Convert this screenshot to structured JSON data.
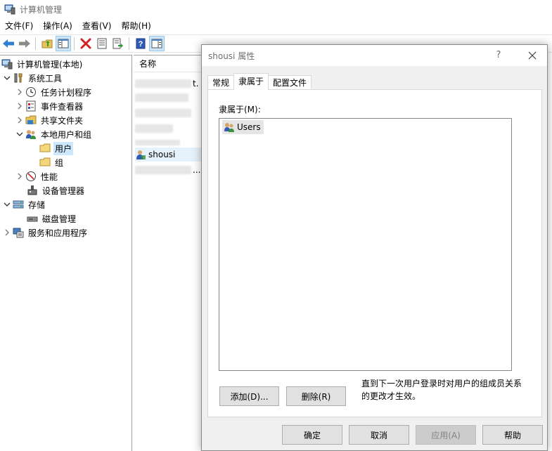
{
  "window": {
    "title": "计算机管理"
  },
  "menu": [
    "文件(F)",
    "操作(A)",
    "查看(V)",
    "帮助(H)"
  ],
  "toolbar": {
    "icons": [
      "back-arrow-icon",
      "forward-arrow-icon",
      "up-folder-icon",
      "show-hide-tree-icon",
      "delete-icon",
      "properties-icon",
      "export-list-icon",
      "help-icon",
      "show-action-pane-icon"
    ]
  },
  "tree": {
    "root": "计算机管理(本地)",
    "system_tools": "系统工具",
    "task_scheduler": "任务计划程序",
    "event_viewer": "事件查看器",
    "shared_folders": "共享文件夹",
    "local_users_groups": "本地用户和组",
    "users": "用户",
    "groups": "组",
    "performance": "性能",
    "device_manager": "设备管理器",
    "storage": "存储",
    "disk_management": "磁盘管理",
    "services_apps": "服务和应用程序"
  },
  "list": {
    "header": "名称",
    "rows": [
      {
        "name": "t.",
        "blurred": true
      },
      {
        "name": "",
        "blurred": true
      },
      {
        "name": "",
        "blurred": true
      },
      {
        "name": "",
        "blurred": true
      },
      {
        "name": "",
        "blurred": true
      },
      {
        "name": "shousi",
        "blurred": false
      },
      {
        "name": "...",
        "blurred": true
      }
    ]
  },
  "dialog": {
    "title": "shousi 属性",
    "help_glyph": "?",
    "tabs": [
      "常规",
      "隶属于",
      "配置文件"
    ],
    "active_tab": "隶属于",
    "member_of_label": "隶属于(M):",
    "members": [
      "Users"
    ],
    "add_button": "添加(D)...",
    "remove_button": "删除(R)",
    "note": "直到下一次用户登录时对用户的组成员关系的更改才生效。",
    "ok": "确定",
    "cancel": "取消",
    "apply": "应用(A)",
    "help": "帮助"
  }
}
